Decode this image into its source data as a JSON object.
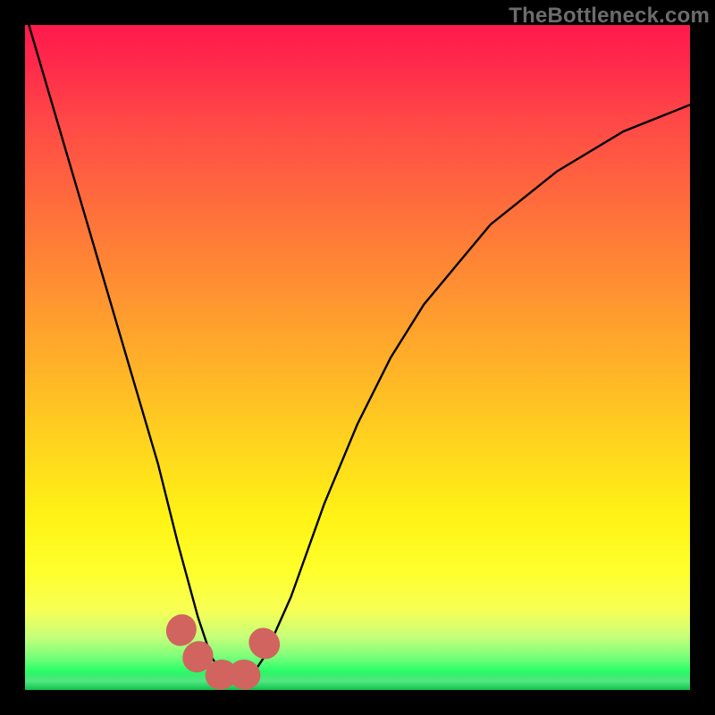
{
  "attribution": "TheBottleneck.com",
  "colors": {
    "frame": "#000000",
    "gradient_top": "#ff1a4d",
    "gradient_bottom": "#0cc24a",
    "curve": "#000000",
    "marker": "#d1645e"
  },
  "chart_data": {
    "type": "line",
    "title": "",
    "xlabel": "",
    "ylabel": "",
    "xlim": [
      0,
      100
    ],
    "ylim": [
      0,
      100
    ],
    "grid": false,
    "legend": false,
    "series": [
      {
        "name": "bottleneck-curve",
        "x": [
          0,
          5,
          10,
          15,
          20,
          23,
          26,
          28,
          30,
          32,
          34,
          36,
          40,
          45,
          50,
          55,
          60,
          70,
          80,
          90,
          100
        ],
        "y": [
          102,
          85,
          68,
          51,
          34,
          22,
          11,
          5,
          2,
          1,
          2,
          5,
          14,
          28,
          40,
          50,
          58,
          70,
          78,
          84,
          88
        ]
      }
    ],
    "markers": [
      {
        "x": 23.5,
        "y": 9,
        "w": 2.2,
        "h": 5,
        "angle": -65
      },
      {
        "x": 26.0,
        "y": 5,
        "w": 2.2,
        "h": 5,
        "angle": -55
      },
      {
        "x": 29.5,
        "y": 2.3,
        "w": 2.2,
        "h": 5,
        "angle": -20
      },
      {
        "x": 33.0,
        "y": 2.3,
        "w": 2.2,
        "h": 5,
        "angle": 15
      },
      {
        "x": 36.0,
        "y": 7,
        "w": 2.2,
        "h": 5,
        "angle": 45
      }
    ],
    "annotations": []
  }
}
